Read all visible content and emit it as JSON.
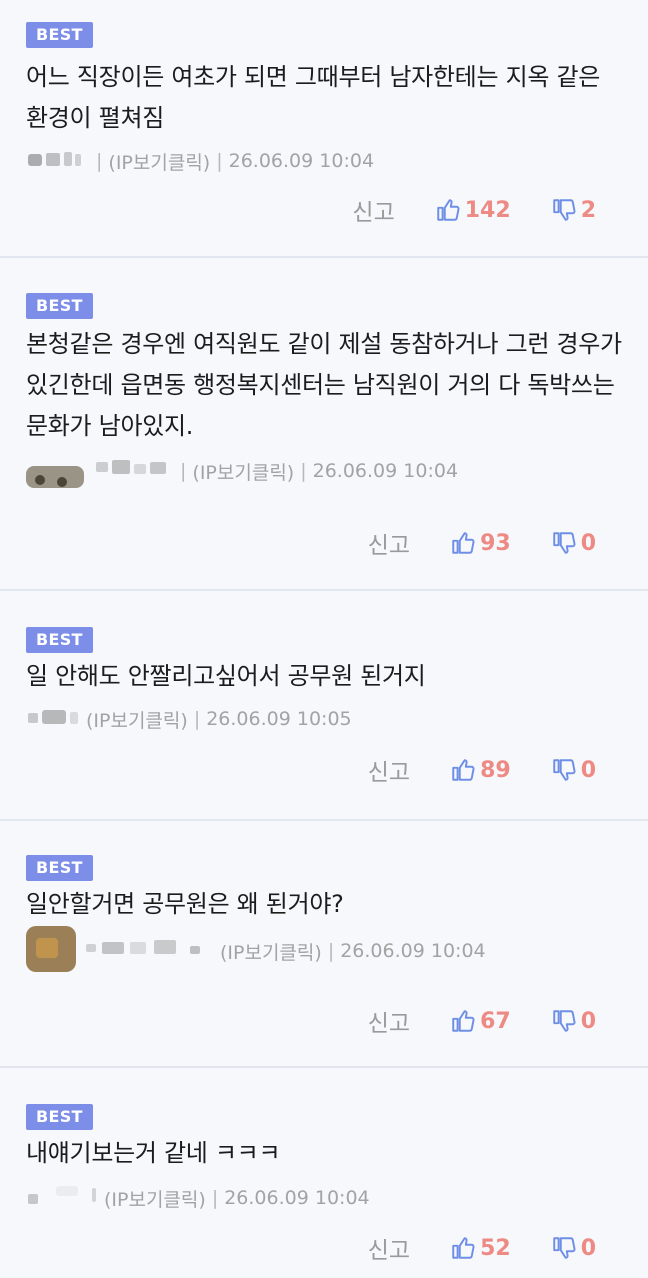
{
  "report_label": "신고",
  "badge_label": "BEST",
  "ip_label": "(IP보기클릭)",
  "separator": "|",
  "colors": {
    "badge": "#7d8ee8",
    "vote_count": "#ee8a84",
    "thumb_icon": "#6f8fe6",
    "report": "#9a9a9a",
    "background": "#f6f8fc"
  },
  "comments": [
    {
      "text": "어느 직장이든 여초가 되면 그때부터 남자한테는 지옥 같은 환경이 펼쳐짐",
      "date": "26.06.09 10:04",
      "likes": "142",
      "dislikes": "2"
    },
    {
      "text": "본청같은 경우엔 여직원도 같이 제설 동참하거나 그런 경우가 있긴한데 읍면동 행정복지센터는 남직원이 거의 다 독박쓰는 문화가 남아있지.",
      "date": "26.06.09 10:04",
      "likes": "93",
      "dislikes": "0"
    },
    {
      "text": "일 안해도 안짤리고싶어서 공무원 된거지",
      "date": "26.06.09 10:05",
      "likes": "89",
      "dislikes": "0"
    },
    {
      "text": "일안할거면 공무원은 왜 된거야?",
      "date": "26.06.09 10:04",
      "likes": "67",
      "dislikes": "0"
    },
    {
      "text": "내얘기보는거 같네 ㅋㅋㅋ",
      "date": "26.06.09 10:04",
      "likes": "52",
      "dislikes": "0"
    }
  ]
}
